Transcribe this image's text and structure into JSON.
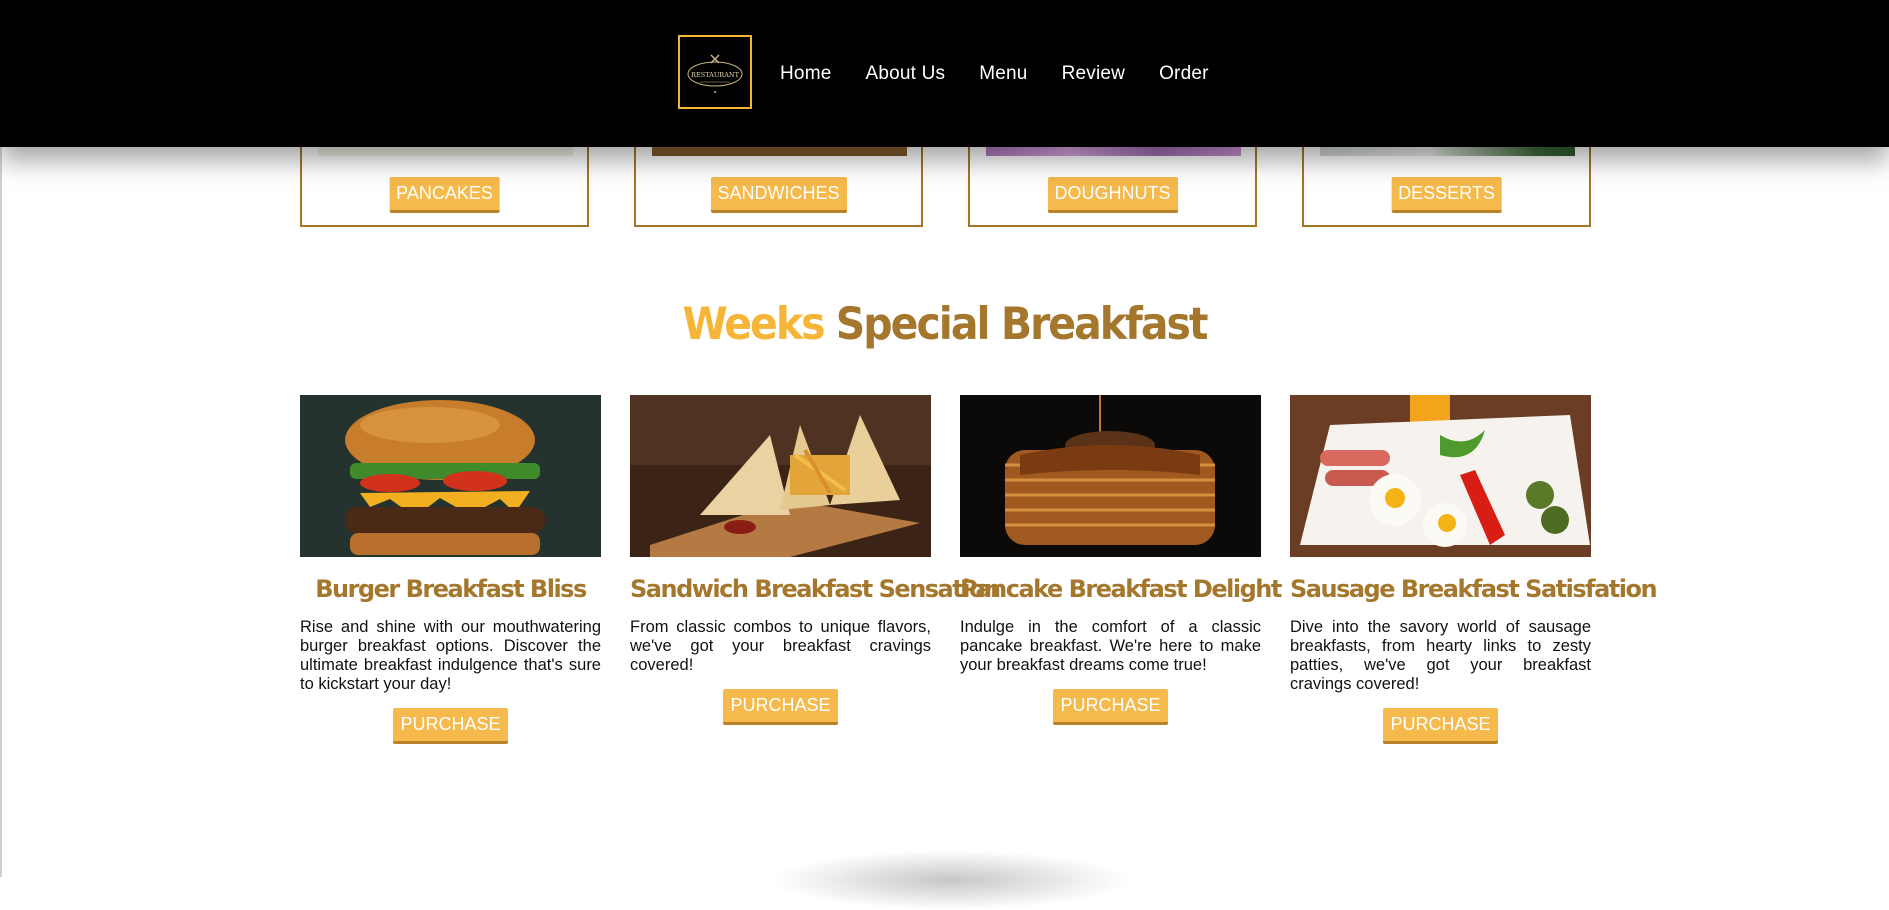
{
  "nav": {
    "logo_text": "RESTAURANT",
    "links": [
      "Home",
      "About Us",
      "Menu",
      "Review",
      "Order"
    ]
  },
  "categories": [
    {
      "label": "PANCAKES"
    },
    {
      "label": "SANDWICHES"
    },
    {
      "label": "DOUGHNUTS"
    },
    {
      "label": "DESSERTS"
    }
  ],
  "section": {
    "title_part1": "Weeks",
    "title_part2": "Special Breakfast"
  },
  "products": [
    {
      "title": "Burger Breakfast Bliss",
      "description": "Rise and shine with our mouthwatering burger breakfast options. Discover the ultimate breakfast indulgence that's sure to kickstart your day!",
      "button": "PURCHASE",
      "image_icon": "burger-image"
    },
    {
      "title": "Sandwich Breakfast Sensation",
      "description": "From classic combos to unique flavors, we've got your breakfast cravings covered!",
      "button": "PURCHASE",
      "image_icon": "sandwich-image"
    },
    {
      "title": "Pancake Breakfast Delight",
      "description": "Indulge in the comfort of a classic pancake breakfast. We're here to make your breakfast dreams come true!",
      "button": "PURCHASE",
      "image_icon": "pancake-image"
    },
    {
      "title": "Sausage Breakfast Satisfation",
      "description": "Dive into the savory world of sausage breakfasts, from hearty links to zesty patties, we've got your breakfast cravings covered!",
      "button": "PURCHASE",
      "image_icon": "sausage-image"
    }
  ],
  "colors": {
    "accent": "#f5b94c",
    "brown": "#a5772d",
    "nav_bg": "#000000"
  }
}
